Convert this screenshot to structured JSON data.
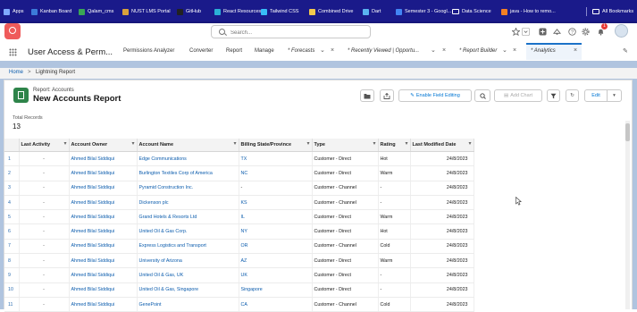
{
  "bookmarks": [
    {
      "label": "Apps",
      "color": "#7fa8ff"
    },
    {
      "label": "Kanban Board",
      "color": "#3c7bd9"
    },
    {
      "label": "Qalam_cms",
      "color": "#3aa655"
    },
    {
      "label": "NUST LMS Portal",
      "color": "#d9a13c"
    },
    {
      "label": "GitHub",
      "color": "#222222"
    },
    {
      "label": "React Resources",
      "color": "#2bb0d6"
    },
    {
      "label": "Tailwind CSS",
      "color": "#38bdf8"
    },
    {
      "label": "Combined Drive",
      "color": "#f2c94c"
    },
    {
      "label": "Dart",
      "color": "#5ab3f0"
    },
    {
      "label": "Semester 3 - Googl...",
      "color": "#4285f4"
    },
    {
      "label": "Data Science",
      "color": "#cccccc"
    },
    {
      "label": "java - How to remo...",
      "color": "#f48024"
    },
    {
      "label": "All Bookmarks",
      "color": "#ffffff"
    }
  ],
  "header": {
    "search_placeholder": "Search...",
    "notification_count": "1"
  },
  "nav": {
    "app_name": "User Access & Perm...",
    "items": [
      {
        "label": "Permissions Analyzer"
      },
      {
        "label": "Converter"
      },
      {
        "label": "Report"
      },
      {
        "label": "Manage"
      },
      {
        "label": "* Forecasts"
      },
      {
        "label": "* Recently Viewed | Opportu..."
      },
      {
        "label": "* Report Builder"
      },
      {
        "label": "* Analytics"
      }
    ]
  },
  "breadcrumb": {
    "home": "Home",
    "sep": ">",
    "current": "Lightning Report"
  },
  "report": {
    "subtitle": "Report: Accounts",
    "title": "New Accounts Report",
    "buttons": {
      "enable_field_editing": "Enable Field Editing",
      "add_chart": "Add Chart",
      "edit": "Edit"
    },
    "total_records_label": "Total Records",
    "total_records_value": "13"
  },
  "table": {
    "columns": [
      "",
      "Last Activity",
      "Account Owner",
      "Account Name",
      "Billing State/Province",
      "Type",
      "Rating",
      "Last Modified Date"
    ],
    "rows": [
      [
        "1",
        "-",
        "Ahmed Bilal Siddiqui",
        "Edge Communications",
        "TX",
        "Customer - Direct",
        "Hot",
        "24/8/2023"
      ],
      [
        "2",
        "-",
        "Ahmed Bilal Siddiqui",
        "Burlington Textiles Corp of America",
        "NC",
        "Customer - Direct",
        "Warm",
        "24/8/2023"
      ],
      [
        "3",
        "-",
        "Ahmed Bilal Siddiqui",
        "Pyramid Construction Inc.",
        "-",
        "Customer - Channel",
        "-",
        "24/8/2023"
      ],
      [
        "4",
        "-",
        "Ahmed Bilal Siddiqui",
        "Dickenson plc",
        "KS",
        "Customer - Channel",
        "-",
        "24/8/2023"
      ],
      [
        "5",
        "-",
        "Ahmed Bilal Siddiqui",
        "Grand Hotels & Resorts Ltd",
        "IL",
        "Customer - Direct",
        "Warm",
        "24/8/2023"
      ],
      [
        "6",
        "-",
        "Ahmed Bilal Siddiqui",
        "United Oil & Gas Corp.",
        "NY",
        "Customer - Direct",
        "Hot",
        "24/8/2023"
      ],
      [
        "7",
        "-",
        "Ahmed Bilal Siddiqui",
        "Express Logistics and Transport",
        "OR",
        "Customer - Channel",
        "Cold",
        "24/8/2023"
      ],
      [
        "8",
        "-",
        "Ahmed Bilal Siddiqui",
        "University of Arizona",
        "AZ",
        "Customer - Direct",
        "Warm",
        "24/8/2023"
      ],
      [
        "9",
        "-",
        "Ahmed Bilal Siddiqui",
        "United Oil & Gas, UK",
        "UK",
        "Customer - Direct",
        "-",
        "24/8/2023"
      ],
      [
        "10",
        "-",
        "Ahmed Bilal Siddiqui",
        "United Oil & Gas, Singapore",
        "Singapore",
        "Customer - Direct",
        "-",
        "24/8/2023"
      ],
      [
        "11",
        "-",
        "Ahmed Bilal Siddiqui",
        "GenePoint",
        "CA",
        "Customer - Channel",
        "Cold",
        "24/8/2023"
      ]
    ]
  },
  "colors": {
    "bookmarks_bar": "#1a1a8a",
    "accent": "#0176d3",
    "content_bg": "#b0c4df",
    "report_icon": "#2e844a",
    "logo": "#ef5b5b"
  }
}
